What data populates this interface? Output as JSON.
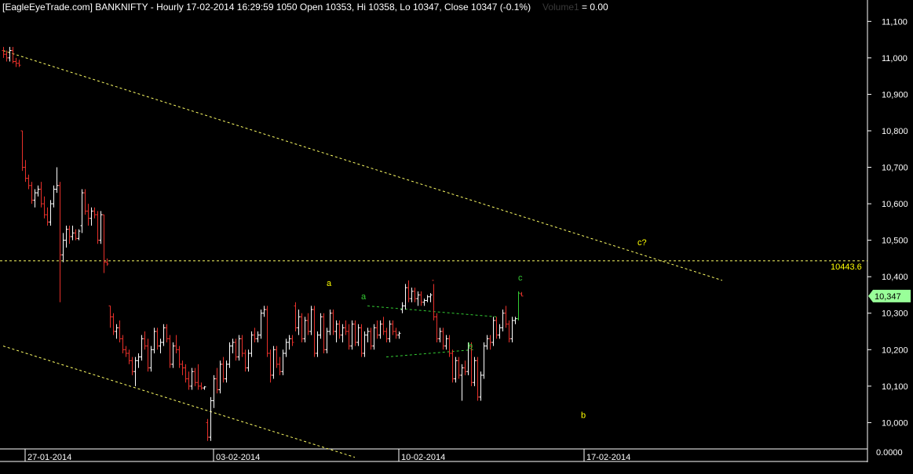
{
  "header": {
    "title": "[EagleEyeTrade.com] BANKNIFTY - Hourly 17-02-2014 16:29:59 1050 Open 10353, Hi 10358, Lo 10347, Close 10347 (-0.1%)",
    "volume_label": "Volume1",
    "volume_value": "= 0.00"
  },
  "colors": {
    "background": "#000000",
    "axis": "#ffffff",
    "up_bar": "#ffffff",
    "down_bar": "#e8302a",
    "trendline_yellow": "#ffff66",
    "channel_green": "#33cc33",
    "last_price_tag": "#99ff99",
    "level_tag_text": "#ffff00"
  },
  "chart_data": {
    "type": "ohlc",
    "symbol": "BANKNIFTY",
    "interval": "Hourly",
    "ylim": [
      9930,
      11120
    ],
    "yticks": [
      "11,100",
      "11,000",
      "10,900",
      "10,800",
      "10,700",
      "10,600",
      "10,500",
      "10,400",
      "10,300",
      "10,200",
      "10,100",
      "10,000"
    ],
    "ytick_values": [
      11100,
      11000,
      10900,
      10800,
      10700,
      10600,
      10500,
      10400,
      10300,
      10200,
      10100,
      10000
    ],
    "bottom_label": "0.0000",
    "date_labels": [
      "27-01-2014",
      "03-02-2014",
      "10-02-2014",
      "17-02-2014"
    ],
    "date_bar_index": [
      7,
      67,
      126,
      185
    ],
    "bars": [
      [
        11020,
        11030,
        11000,
        11010
      ],
      [
        11010,
        11020,
        10990,
        11000
      ],
      [
        11000,
        11030,
        10990,
        11020
      ],
      [
        11020,
        11030,
        10985,
        10990
      ],
      [
        10990,
        11000,
        10975,
        10985
      ],
      [
        10985,
        10995,
        10975,
        10980
      ],
      [
        10800,
        10800,
        10690,
        10700
      ],
      [
        10700,
        10720,
        10660,
        10670
      ],
      [
        10670,
        10680,
        10640,
        10650
      ],
      [
        10650,
        10660,
        10600,
        10610
      ],
      [
        10610,
        10640,
        10590,
        10630
      ],
      [
        10630,
        10650,
        10620,
        10640
      ],
      [
        10640,
        10660,
        10590,
        10600
      ],
      [
        10600,
        10620,
        10560,
        10570
      ],
      [
        10570,
        10590,
        10540,
        10550
      ],
      [
        10550,
        10610,
        10540,
        10600
      ],
      [
        10600,
        10650,
        10590,
        10640
      ],
      [
        10640,
        10700,
        10630,
        10650
      ],
      [
        10650,
        10660,
        10330,
        10460
      ],
      [
        10460,
        10520,
        10440,
        10500
      ],
      [
        10500,
        10540,
        10480,
        10530
      ],
      [
        10530,
        10540,
        10490,
        10510
      ],
      [
        10510,
        10540,
        10500,
        10520
      ],
      [
        10520,
        10530,
        10500,
        10505
      ],
      [
        10505,
        10530,
        10500,
        10525
      ],
      [
        10540,
        10640,
        10520,
        10630
      ],
      [
        10630,
        10640,
        10570,
        10580
      ],
      [
        10580,
        10600,
        10540,
        10560
      ],
      [
        10560,
        10590,
        10540,
        10580
      ],
      [
        10580,
        10590,
        10560,
        10570
      ],
      [
        10570,
        10580,
        10490,
        10500
      ],
      [
        10500,
        10580,
        10490,
        10570
      ],
      [
        10570,
        10570,
        10410,
        10440
      ],
      [
        10440,
        10450,
        10430,
        10435
      ],
      [
        10320,
        10320,
        10260,
        10290
      ],
      [
        10290,
        10300,
        10240,
        10250
      ],
      [
        10250,
        10270,
        10230,
        10260
      ],
      [
        10260,
        10280,
        10220,
        10230
      ],
      [
        10230,
        10240,
        10190,
        10200
      ],
      [
        10200,
        10210,
        10180,
        10190
      ],
      [
        10190,
        10200,
        10160,
        10170
      ],
      [
        10170,
        10180,
        10130,
        10140
      ],
      [
        10140,
        10180,
        10100,
        10170
      ],
      [
        10170,
        10190,
        10150,
        10180
      ],
      [
        10180,
        10240,
        10170,
        10230
      ],
      [
        10230,
        10250,
        10200,
        10210
      ],
      [
        10210,
        10230,
        10140,
        10150
      ],
      [
        10150,
        10210,
        10140,
        10200
      ],
      [
        10200,
        10260,
        10190,
        10250
      ],
      [
        10250,
        10260,
        10200,
        10210
      ],
      [
        10210,
        10230,
        10190,
        10220
      ],
      [
        10220,
        10270,
        10210,
        10260
      ],
      [
        10260,
        10270,
        10220,
        10230
      ],
      [
        10230,
        10240,
        10150,
        10160
      ],
      [
        10160,
        10220,
        10150,
        10210
      ],
      [
        10210,
        10240,
        10190,
        10200
      ],
      [
        10200,
        10210,
        10150,
        10160
      ],
      [
        10160,
        10170,
        10130,
        10150
      ],
      [
        10150,
        10160,
        10110,
        10120
      ],
      [
        10120,
        10140,
        10090,
        10100
      ],
      [
        10100,
        10150,
        10090,
        10140
      ],
      [
        10140,
        10150,
        10100,
        10110
      ],
      [
        10110,
        10160,
        10090,
        10100
      ],
      [
        10100,
        10110,
        10090,
        10095
      ],
      [
        10095,
        10100,
        10090,
        10098
      ],
      [
        10000,
        10010,
        9950,
        9960
      ],
      [
        9960,
        10070,
        9950,
        10060
      ],
      [
        10060,
        10130,
        10040,
        10120
      ],
      [
        10120,
        10150,
        10080,
        10090
      ],
      [
        10090,
        10170,
        10080,
        10160
      ],
      [
        10160,
        10180,
        10110,
        10120
      ],
      [
        10120,
        10170,
        10110,
        10160
      ],
      [
        10160,
        10220,
        10150,
        10210
      ],
      [
        10210,
        10230,
        10190,
        10220
      ],
      [
        10220,
        10230,
        10170,
        10180
      ],
      [
        10180,
        10240,
        10170,
        10230
      ],
      [
        10230,
        10240,
        10180,
        10190
      ],
      [
        10190,
        10200,
        10140,
        10150
      ],
      [
        10150,
        10200,
        10140,
        10190
      ],
      [
        10190,
        10250,
        10180,
        10240
      ],
      [
        10240,
        10260,
        10220,
        10230
      ],
      [
        10230,
        10250,
        10220,
        10240
      ],
      [
        10240,
        10310,
        10230,
        10300
      ],
      [
        10300,
        10320,
        10290,
        10310
      ],
      [
        10310,
        10320,
        10180,
        10190
      ],
      [
        10190,
        10200,
        10110,
        10130
      ],
      [
        10130,
        10210,
        10120,
        10200
      ],
      [
        10200,
        10210,
        10150,
        10160
      ],
      [
        10160,
        10180,
        10130,
        10140
      ],
      [
        10140,
        10200,
        10130,
        10190
      ],
      [
        10190,
        10230,
        10180,
        10220
      ],
      [
        10220,
        10240,
        10200,
        10230
      ],
      [
        10230,
        10240,
        10210,
        10220
      ],
      [
        10320,
        10330,
        10250,
        10260
      ],
      [
        10260,
        10310,
        10240,
        10290
      ],
      [
        10290,
        10300,
        10220,
        10230
      ],
      [
        10230,
        10290,
        10220,
        10280
      ],
      [
        10280,
        10300,
        10240,
        10250
      ],
      [
        10250,
        10320,
        10240,
        10310
      ],
      [
        10310,
        10320,
        10180,
        10190
      ],
      [
        10190,
        10250,
        10180,
        10240
      ],
      [
        10240,
        10300,
        10230,
        10290
      ],
      [
        10290,
        10300,
        10190,
        10200
      ],
      [
        10200,
        10260,
        10190,
        10250
      ],
      [
        10250,
        10310,
        10240,
        10300
      ],
      [
        10300,
        10310,
        10240,
        10250
      ],
      [
        10250,
        10280,
        10220,
        10270
      ],
      [
        10270,
        10280,
        10230,
        10240
      ],
      [
        10240,
        10270,
        10220,
        10260
      ],
      [
        10260,
        10280,
        10240,
        10250
      ],
      [
        10250,
        10270,
        10200,
        10210
      ],
      [
        10210,
        10280,
        10200,
        10270
      ],
      [
        10270,
        10280,
        10210,
        10220
      ],
      [
        10220,
        10270,
        10210,
        10260
      ],
      [
        10260,
        10270,
        10180,
        10190
      ],
      [
        10190,
        10250,
        10180,
        10240
      ],
      [
        10240,
        10260,
        10220,
        10250
      ],
      [
        10250,
        10260,
        10200,
        10210
      ],
      [
        10210,
        10270,
        10200,
        10260
      ],
      [
        10260,
        10280,
        10230,
        10240
      ],
      [
        10240,
        10280,
        10230,
        10270
      ],
      [
        10270,
        10290,
        10240,
        10250
      ],
      [
        10250,
        10260,
        10220,
        10230
      ],
      [
        10230,
        10280,
        10220,
        10270
      ],
      [
        10270,
        10280,
        10240,
        10250
      ],
      [
        10250,
        10260,
        10230,
        10240
      ],
      [
        10240,
        10250,
        10230,
        10245
      ],
      [
        10310,
        10330,
        10300,
        10320
      ],
      [
        10320,
        10380,
        10310,
        10370
      ],
      [
        10370,
        10390,
        10330,
        10340
      ],
      [
        10340,
        10370,
        10330,
        10360
      ],
      [
        10360,
        10370,
        10330,
        10340
      ],
      [
        10340,
        10360,
        10320,
        10350
      ],
      [
        10350,
        10360,
        10320,
        10330
      ],
      [
        10330,
        10340,
        10320,
        10335
      ],
      [
        10335,
        10350,
        10330,
        10345
      ],
      [
        10345,
        10355,
        10330,
        10350
      ],
      [
        10390,
        10380,
        10280,
        10290
      ],
      [
        10290,
        10300,
        10220,
        10230
      ],
      [
        10230,
        10260,
        10220,
        10250
      ],
      [
        10250,
        10260,
        10200,
        10210
      ],
      [
        10210,
        10240,
        10200,
        10230
      ],
      [
        10230,
        10240,
        10180,
        10190
      ],
      [
        10190,
        10200,
        10110,
        10120
      ],
      [
        10120,
        10180,
        10110,
        10170
      ],
      [
        10170,
        10180,
        10120,
        10130
      ],
      [
        10130,
        10160,
        10060,
        10150
      ],
      [
        10150,
        10170,
        10130,
        10140
      ],
      [
        10140,
        10220,
        10130,
        10210
      ],
      [
        10210,
        10220,
        10100,
        10110
      ],
      [
        10110,
        10180,
        10100,
        10170
      ],
      [
        10170,
        10180,
        10060,
        10070
      ],
      [
        10070,
        10140,
        10060,
        10130
      ],
      [
        10130,
        10220,
        10120,
        10210
      ],
      [
        10210,
        10240,
        10200,
        10230
      ],
      [
        10230,
        10240,
        10200,
        10220
      ],
      [
        10220,
        10290,
        10210,
        10280
      ],
      [
        10280,
        10290,
        10230,
        10240
      ],
      [
        10240,
        10270,
        10230,
        10260
      ],
      [
        10260,
        10310,
        10250,
        10300
      ],
      [
        10300,
        10320,
        10260,
        10270
      ],
      [
        10270,
        10280,
        10220,
        10230
      ],
      [
        10230,
        10290,
        10220,
        10280
      ],
      [
        10280,
        10290,
        10270,
        10285
      ],
      [
        10285,
        10360,
        10280,
        10355
      ],
      [
        10353,
        10358,
        10347,
        10347
      ]
    ],
    "horizontal_level": {
      "value": 10443.6,
      "label": "10443.6"
    },
    "last_price": {
      "value": 10347,
      "label": "10,347"
    },
    "trendlines": [
      {
        "color": "yellow",
        "from": [
          0,
          11020
        ],
        "to": [
          229,
          10390
        ]
      },
      {
        "color": "yellow",
        "from": [
          0,
          10210
        ],
        "to": [
          112,
          9905
        ]
      },
      {
        "color": "green",
        "from": [
          116,
          10320
        ],
        "to": [
          157,
          10290
        ]
      },
      {
        "color": "green",
        "from": [
          122,
          10180
        ],
        "to": [
          150,
          10200
        ]
      }
    ],
    "wave_labels": [
      {
        "text": "a",
        "bar": 103,
        "value": 10375,
        "color": "yellow"
      },
      {
        "text": "a",
        "bar": 114,
        "value": 10338,
        "color": "green"
      },
      {
        "text": "b",
        "bar": 148,
        "value": 10203,
        "color": "green"
      },
      {
        "text": "c",
        "bar": 164,
        "value": 10390,
        "color": "green"
      },
      {
        "text": "b",
        "bar": 184,
        "value": 10013,
        "color": "yellow"
      },
      {
        "text": "c?",
        "bar": 202,
        "value": 10486,
        "color": "yellow"
      }
    ]
  }
}
